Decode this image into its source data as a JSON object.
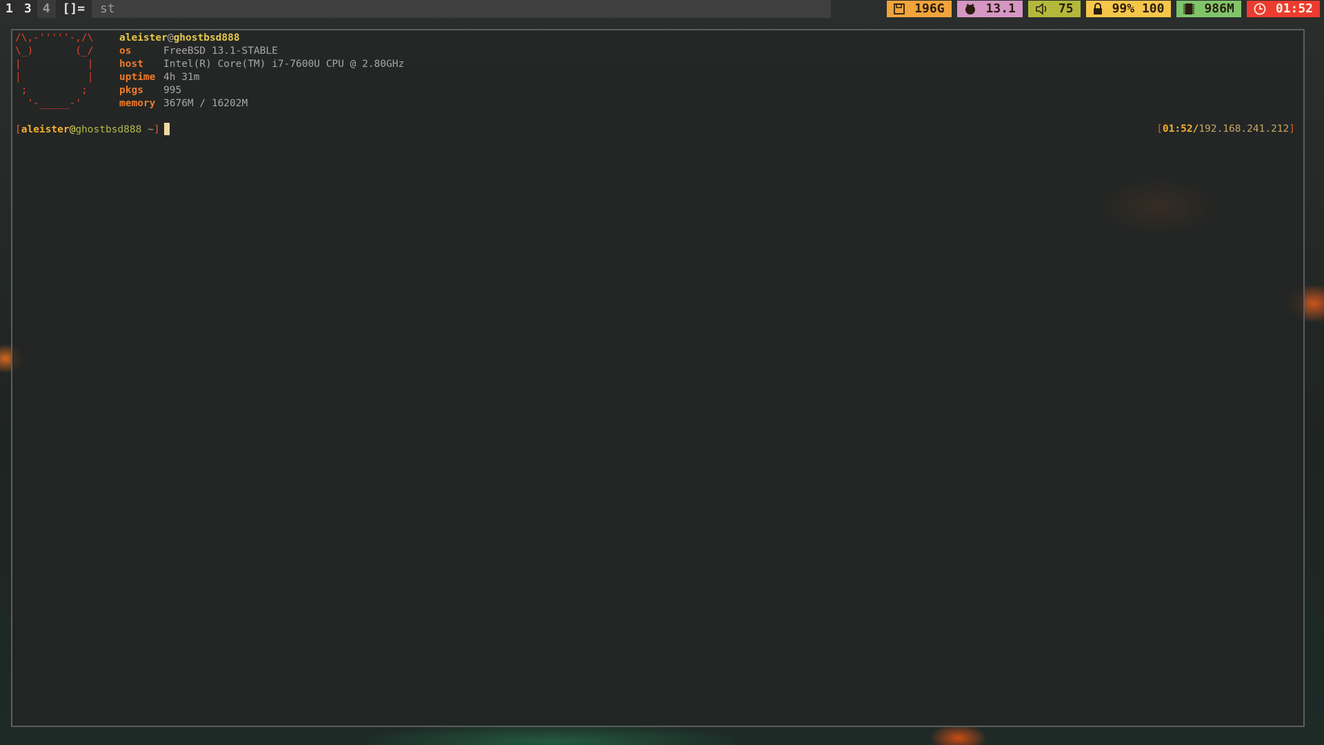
{
  "bar": {
    "tags": [
      "1",
      "3",
      "4"
    ],
    "layout_symbol": "[]=",
    "window_title": "st",
    "status": {
      "disk": {
        "icon": "disk-icon",
        "value": "196G"
      },
      "cpu": {
        "icon": "cpu-icon",
        "value": "13.1"
      },
      "volume": {
        "icon": "speaker-icon",
        "value": "75"
      },
      "battery": {
        "icon": "battery-lock-icon",
        "value": "99% 100"
      },
      "memory": {
        "icon": "memory-icon",
        "value": "986M"
      },
      "clock": {
        "icon": "clock-icon",
        "value": "01:52"
      }
    },
    "colors": {
      "disk": "#f0a43a",
      "cpu": "#d596c4",
      "volume": "#b4b83a",
      "battery": "#f6c64a",
      "memory": "#7fc46a",
      "clock": "#ec3b2f"
    }
  },
  "terminal": {
    "ascii_logo": [
      "/\\,-'''''-,/\\",
      "\\_)       (_/",
      "|           |",
      "|           |",
      " ;         ;",
      "  '-_____-'"
    ],
    "fetch": {
      "user": "aleister",
      "at": "@",
      "host": "ghostbsd888",
      "rows": [
        {
          "label": "os",
          "value": "FreeBSD 13.1-STABLE"
        },
        {
          "label": "host",
          "value": "Intel(R) Core(TM) i7-7600U CPU @ 2.80GHz"
        },
        {
          "label": "uptime",
          "value": "4h 31m"
        },
        {
          "label": "pkgs",
          "value": "995"
        },
        {
          "label": "memory",
          "value": "3676M / 16202M"
        }
      ]
    },
    "prompt": {
      "open": "[",
      "user": "aleister",
      "at": "@",
      "host": "ghostbsd888",
      "dir": " ~",
      "close": "]"
    },
    "rprompt": {
      "open": "[",
      "time": "01:52",
      "sep": "/",
      "ip": "192.168.241.212",
      "close": "]"
    }
  }
}
